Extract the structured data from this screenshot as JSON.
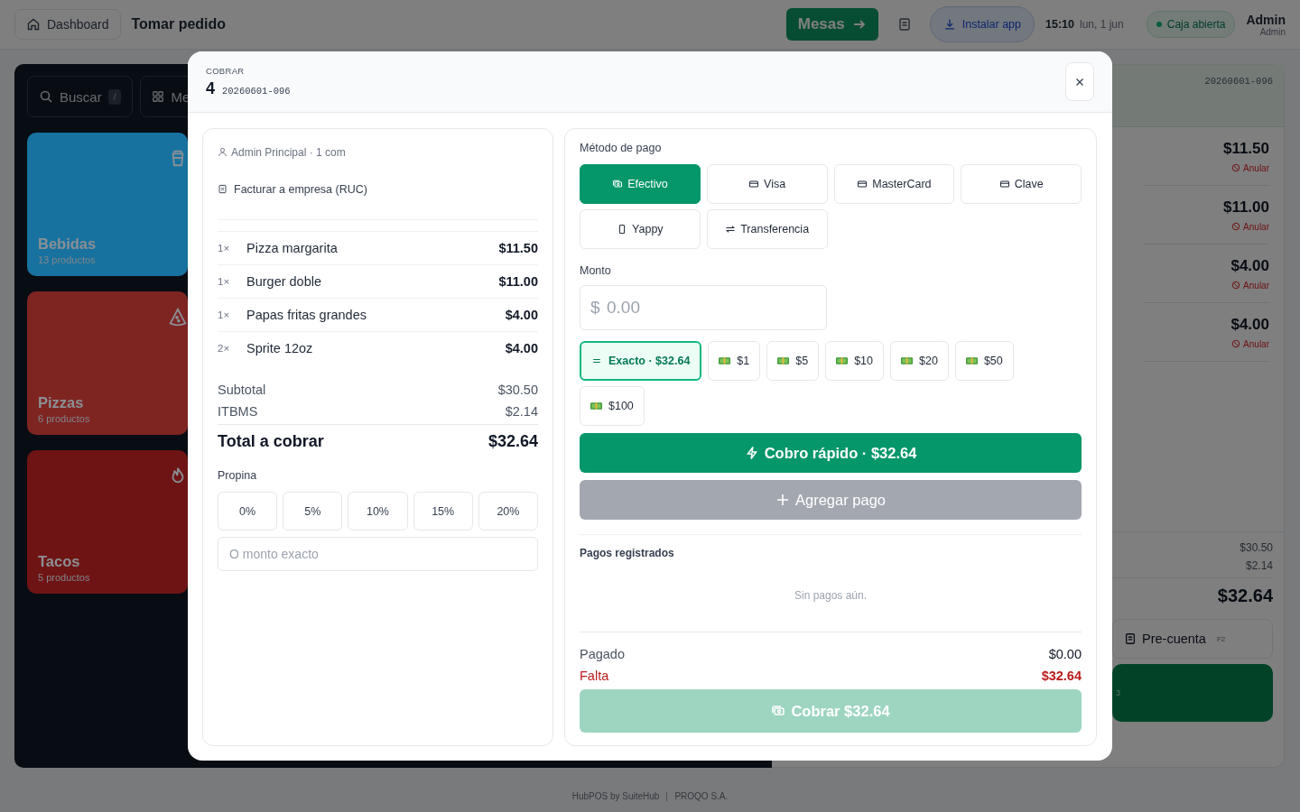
{
  "top_bar": {
    "home_button": "Dashboard",
    "title": "Tomar pedido",
    "tables_button": "Mesas",
    "install_button": "Instalar app",
    "time": "15:10",
    "date": "lun, 1 jun",
    "cash_status": "Caja abierta",
    "user_name": "Admin",
    "user_role": "Admin"
  },
  "catalog": {
    "search": {
      "label": "Buscar",
      "shortcut": "/"
    },
    "menu_button": "Me",
    "categories": [
      {
        "name": "Bebidas",
        "count": "13 productos",
        "color": "#17729f",
        "kind": "drink"
      },
      {
        "name": "Pizzas",
        "count": "6 productos",
        "color": "#7e2522",
        "kind": "pizza"
      },
      {
        "name": "Tacos",
        "count": "5 productos",
        "color": "#6e1414",
        "kind": "spicy"
      }
    ]
  },
  "order_panel": {
    "order_number": "20260601-096",
    "items": [
      {
        "price": "$11.50",
        "void": "Anular"
      },
      {
        "price": "$11.00",
        "void": "Anular"
      },
      {
        "price": "$4.00",
        "void": "Anular"
      },
      {
        "price": "$4.00",
        "void": "Anular"
      }
    ],
    "subtotal": "$30.50",
    "tax": "$2.14",
    "total": "$32.64",
    "precheck": {
      "label": "Pre-cuenta",
      "shortcut": "F2"
    },
    "charge_shortcut": "3"
  },
  "modal": {
    "eyebrow": "COBRAR",
    "table": "4",
    "order_number": "20260601-096",
    "customer": "Admin Principal · 1 com",
    "invoice_toggle": "Facturar a empresa (RUC)",
    "items": [
      {
        "qty": "1×",
        "name": "Pizza margarita",
        "price": "$11.50"
      },
      {
        "qty": "1×",
        "name": "Burger doble",
        "price": "$11.00"
      },
      {
        "qty": "1×",
        "name": "Papas fritas grandes",
        "price": "$4.00"
      },
      {
        "qty": "2×",
        "name": "Sprite 12oz",
        "price": "$4.00"
      }
    ],
    "subtotal": {
      "label": "Subtotal",
      "value": "$30.50"
    },
    "tax": {
      "label": "ITBMS",
      "value": "$2.14"
    },
    "total": {
      "label": "Total a cobrar",
      "value": "$32.64"
    },
    "tip": {
      "label": "Propina",
      "options": [
        {
          "label": "0%",
          "selected": false
        },
        {
          "label": "5%",
          "selected": false
        },
        {
          "label": "10%",
          "selected": false
        },
        {
          "label": "15%",
          "selected": false
        },
        {
          "label": "20%",
          "selected": false
        }
      ],
      "custom_placeholder": "O monto exacto"
    },
    "payment": {
      "method_label": "Método de pago",
      "methods": [
        {
          "label": "Efectivo",
          "kind": "cash",
          "selected": true
        },
        {
          "label": "Visa",
          "kind": "card",
          "selected": false
        },
        {
          "label": "MasterCard",
          "kind": "card",
          "selected": false
        },
        {
          "label": "Clave",
          "kind": "card",
          "selected": false
        },
        {
          "label": "Yappy",
          "kind": "phone",
          "selected": false
        },
        {
          "label": "Transferencia",
          "kind": "transfer",
          "selected": false
        }
      ],
      "amount_label": "Monto",
      "amount_prefix": "$",
      "amount_placeholder": "0.00",
      "quick_amounts": [
        {
          "label": "Exacto · $32.64",
          "kind": "exact",
          "selected": true
        },
        {
          "label": "$1",
          "kind": "bill",
          "selected": false
        },
        {
          "label": "$5",
          "kind": "bill",
          "selected": false
        },
        {
          "label": "$10",
          "kind": "bill",
          "selected": false
        },
        {
          "label": "$20",
          "kind": "bill",
          "selected": false
        },
        {
          "label": "$50",
          "kind": "bill",
          "selected": false
        },
        {
          "label": "$100",
          "kind": "bill",
          "selected": false
        }
      ],
      "quick_pay": "Cobro rápido · $32.64",
      "add_payment": {
        "label": "Agregar pago",
        "disabled": true
      },
      "registered_label": "Pagos registrados",
      "empty": "Sin pagos aún.",
      "paid": {
        "label": "Pagado",
        "value": "$0.00"
      },
      "remaining": {
        "label": "Falta",
        "value": "$32.64"
      },
      "charge": {
        "label": "Cobrar $32.64",
        "disabled": true
      }
    }
  },
  "footer": [
    "HubPOS by SuiteHub",
    "PROQO S.A."
  ]
}
